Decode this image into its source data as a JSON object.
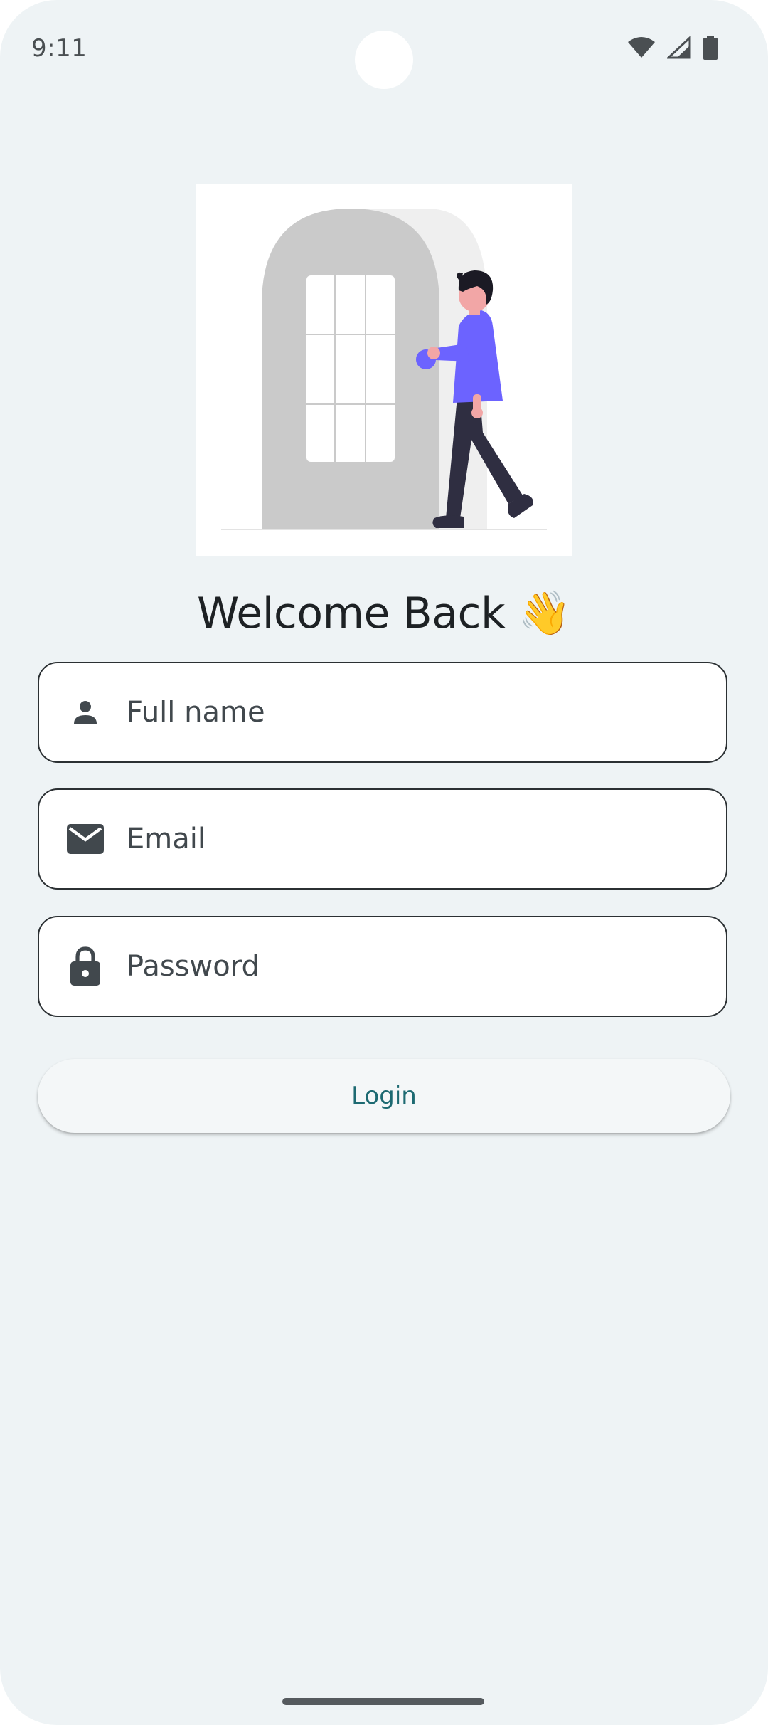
{
  "status_bar": {
    "time": "9:11",
    "icons": [
      "wifi-icon",
      "signal-icon",
      "battery-icon"
    ]
  },
  "illustration": {
    "name": "person-opening-door-illustration"
  },
  "title": {
    "text": "Welcome Back",
    "emoji": "👋"
  },
  "form": {
    "fields": [
      {
        "icon": "person-icon",
        "placeholder": "Full name",
        "value": ""
      },
      {
        "icon": "mail-icon",
        "placeholder": "Email",
        "value": ""
      },
      {
        "icon": "lock-icon",
        "placeholder": "Password",
        "value": ""
      }
    ],
    "login_label": "Login"
  },
  "colors": {
    "background": "#eef3f5",
    "accent_text": "#1d6a72",
    "border": "#2b3033",
    "figure_purple": "#6c63ff"
  }
}
